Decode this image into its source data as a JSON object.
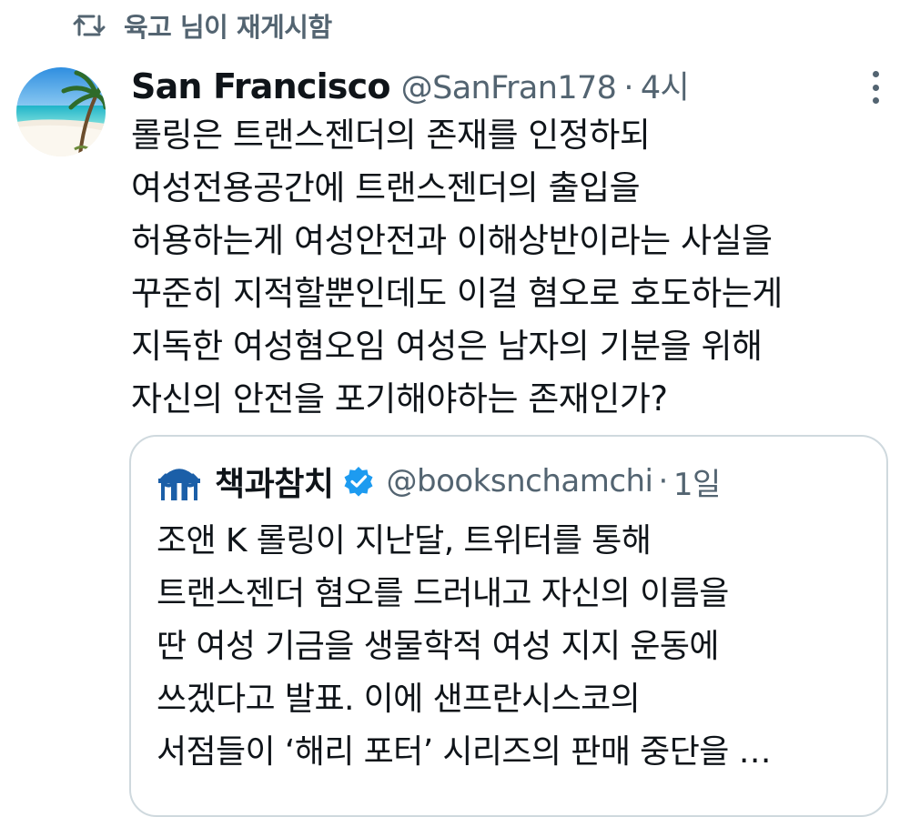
{
  "retweet": {
    "icon": "retweet-icon",
    "text": "육고 님이 재게시함"
  },
  "tweet": {
    "author_name": "San Francisco",
    "author_handle": "@SanFran178",
    "separator": "·",
    "time": "4시",
    "avatar_icon": "beach-palm-avatar",
    "more_icon": "more-vertical-icon",
    "lines": [
      "롤링은 트랜스젠더의 존재를 인정하되",
      "여성전용공간에 트랜스젠더의 출입을",
      "허용하는게 여성안전과 이해상반이라는 사실을",
      "꾸준히 지적할뿐인데도 이걸 혐오로 호도하는게",
      "지독한 여성혐오임 여성은 남자의 기분을 위해",
      "자신의 안전을 포기해야하는 존재인가?"
    ]
  },
  "quote": {
    "author_name": "책과참치",
    "verified": true,
    "verified_icon": "verified-badge-icon",
    "verified_color": "#1d9bf0",
    "author_handle": "@booksnchamchi",
    "separator": "·",
    "time": "1일",
    "avatar_icon": "dome-logo-icon",
    "avatar_color": "#1b5fa8",
    "lines": [
      "조앤 K 롤링이 지난달, 트위터를 통해",
      "트랜스젠더 혐오를 드러내고 자신의 이름을",
      "딴 여성 기금을 생물학적 여성 지지 운동에",
      "쓰겠다고 발표. 이에 샌프란시스코의",
      "서점들이 ‘해리 포터’ 시리즈의 판매 중단을 …"
    ]
  },
  "colors": {
    "text_primary": "#0f1419",
    "text_secondary": "#536471",
    "border": "#cfd9de",
    "accent": "#1d9bf0"
  }
}
